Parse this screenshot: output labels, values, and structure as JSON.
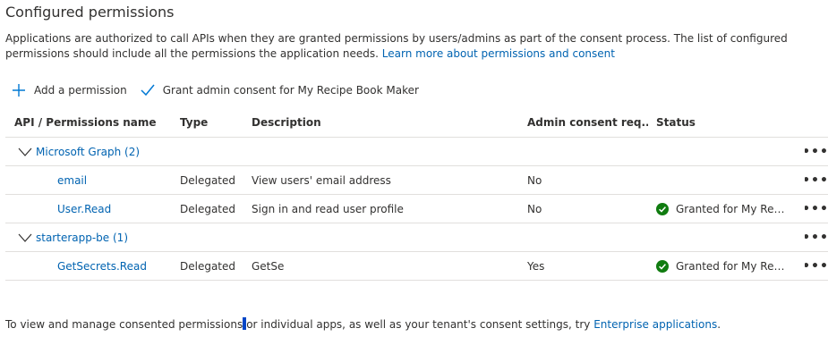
{
  "title": "Configured permissions",
  "description": {
    "text": "Applications are authorized to call APIs when they are granted permissions by users/admins as part of the consent process. The list of configured permissions should include all the permissions the application needs. ",
    "link": "Learn more about permissions and consent"
  },
  "toolbar": {
    "add_label": "Add a permission",
    "grant_label": "Grant admin consent for My Recipe Book Maker"
  },
  "table": {
    "headers": {
      "name": "API / Permissions name",
      "type": "Type",
      "description": "Description",
      "admin": "Admin consent req...",
      "status": "Status"
    },
    "groups": [
      {
        "name": "Microsoft Graph (2)",
        "rows": [
          {
            "name": "email",
            "type": "Delegated",
            "description": "View users' email address",
            "admin": "No",
            "status": ""
          },
          {
            "name": "User.Read",
            "type": "Delegated",
            "description": "Sign in and read user profile",
            "admin": "No",
            "status": "Granted for My Recipe ..."
          }
        ]
      },
      {
        "name": "starterapp-be (1)",
        "rows": [
          {
            "name": "GetSecrets.Read",
            "type": "Delegated",
            "description": "GetSe",
            "admin": "Yes",
            "status": "Granted for My Recipe ..."
          }
        ]
      }
    ],
    "more_label": "•••"
  },
  "footer": {
    "text_before": "To view and manage consented permissions",
    "text_after": "or individual apps, as well as your tenant's consent settings, try ",
    "link": "Enterprise applications",
    "end": "."
  },
  "colors": {
    "link": "#0063b1",
    "accent": "#0078d4",
    "success": "#107c10"
  }
}
